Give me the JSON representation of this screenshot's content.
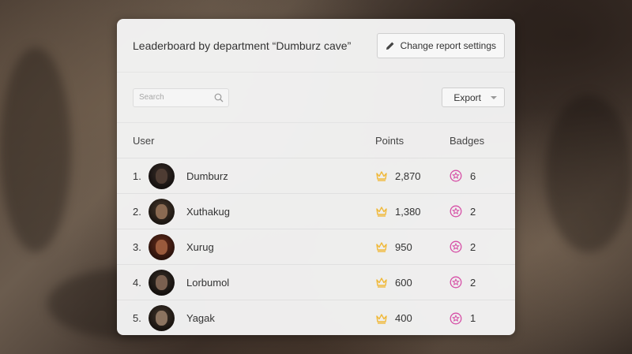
{
  "header": {
    "title": "Leaderboard by department “Dumburz cave”",
    "settings_label": "Change report settings"
  },
  "toolbar": {
    "search_placeholder": "Search",
    "export_label": "Export"
  },
  "table": {
    "columns": {
      "user": "User",
      "points": "Points",
      "badges": "Badges"
    },
    "rows": [
      {
        "rank": "1.",
        "name": "Dumburz",
        "points": "2,870",
        "badges": "6"
      },
      {
        "rank": "2.",
        "name": "Xuthakug",
        "points": "1,380",
        "badges": "2"
      },
      {
        "rank": "3.",
        "name": "Xurug",
        "points": "950",
        "badges": "2"
      },
      {
        "rank": "4.",
        "name": "Lorbumol",
        "points": "600",
        "badges": "2"
      },
      {
        "rank": "5.",
        "name": "Yagak",
        "points": "400",
        "badges": "1"
      }
    ]
  },
  "colors": {
    "crown": "#f0b93a",
    "badge": "#d64fa6"
  },
  "icons": {
    "settings": "pencil-icon",
    "search": "search-icon",
    "export": "chevron-down-icon",
    "points": "crown-icon",
    "badges": "star-badge-icon"
  }
}
